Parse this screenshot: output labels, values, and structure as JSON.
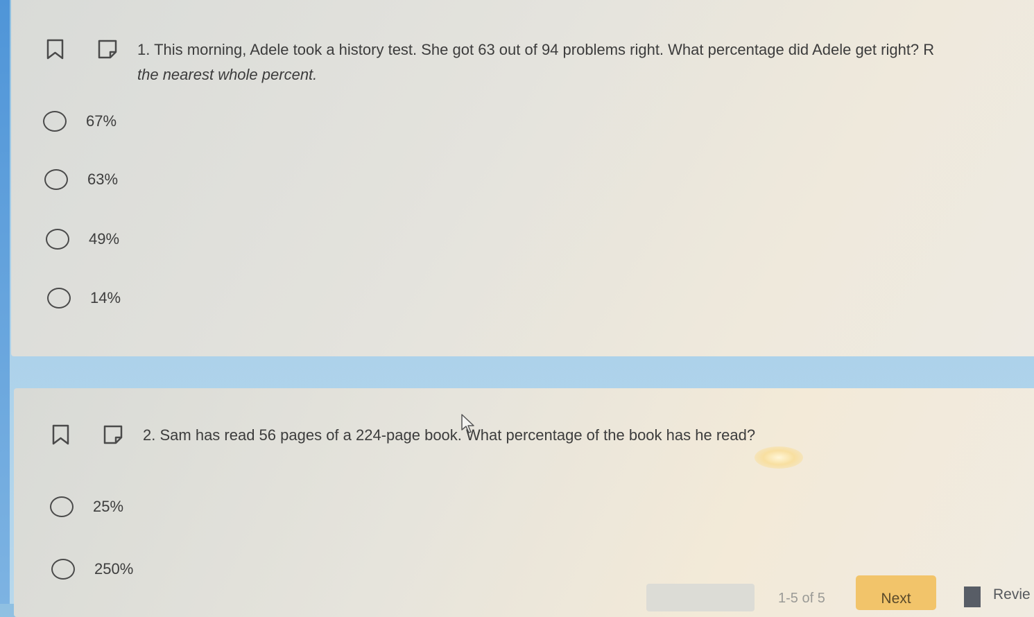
{
  "questions": [
    {
      "number": "1.",
      "text": "This morning, Adele took a history test. She got 63 out of 94 problems right. What percentage did Adele get right? R",
      "subtext": "the nearest whole percent.",
      "choices": [
        "67%",
        "63%",
        "49%",
        "14%"
      ]
    },
    {
      "number": "2.",
      "text": "Sam has read 56 pages of a 224-page book. What percentage of the book has he read?",
      "choices": [
        "25%",
        "250%"
      ]
    }
  ],
  "footer": {
    "progress": "1-5 of 5",
    "next_label": "Next",
    "review_label": "Revie"
  },
  "icons": {
    "bookmark": "bookmark-icon",
    "note": "note-icon",
    "cursor": "mouse-cursor-icon",
    "review": "review-icon"
  }
}
